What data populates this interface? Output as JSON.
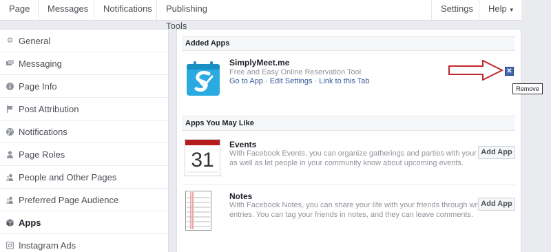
{
  "topnav": {
    "tabs": [
      "Page",
      "Messages",
      "Notifications",
      "Publishing Tools"
    ],
    "settings_label": "Settings",
    "help_label": "Help"
  },
  "sidebar": {
    "items": [
      {
        "label": "General",
        "icon": "gear-icon"
      },
      {
        "label": "Messaging",
        "icon": "message-icon"
      },
      {
        "label": "Page Info",
        "icon": "info-icon"
      },
      {
        "label": "Post Attribution",
        "icon": "flag-icon"
      },
      {
        "label": "Notifications",
        "icon": "globe-icon"
      },
      {
        "label": "Page Roles",
        "icon": "person-icon"
      },
      {
        "label": "People and Other Pages",
        "icon": "people-icon"
      },
      {
        "label": "Preferred Page Audience",
        "icon": "people-icon"
      },
      {
        "label": "Apps",
        "icon": "cube-icon",
        "active": true
      },
      {
        "label": "Instagram Ads",
        "icon": "instagram-icon"
      }
    ]
  },
  "added_apps": {
    "heading": "Added Apps",
    "app": {
      "name": "SimplyMeet.me",
      "description": "Free and Easy Online Reservation Tool",
      "links": [
        "Go to App",
        "Edit Settings",
        "Link to this Tab"
      ],
      "remove_tooltip": "Remove"
    }
  },
  "suggested_apps": {
    "heading": "Apps You May Like",
    "apps": [
      {
        "name": "Events",
        "icon_day": "31",
        "description_line1": "With Facebook Events, you can organize gatherings and parties with your friends,",
        "description_line2": "as well as let people in your community know about upcoming events.",
        "button": "Add App"
      },
      {
        "name": "Notes",
        "description_line1": "With Facebook Notes, you can share your life with your friends through written",
        "description_line2": "entries. You can tag your friends in notes, and they can leave comments.",
        "button": "Add App"
      }
    ]
  },
  "colors": {
    "accent_blue": "#365899",
    "annotation_red": "#c0272d"
  }
}
